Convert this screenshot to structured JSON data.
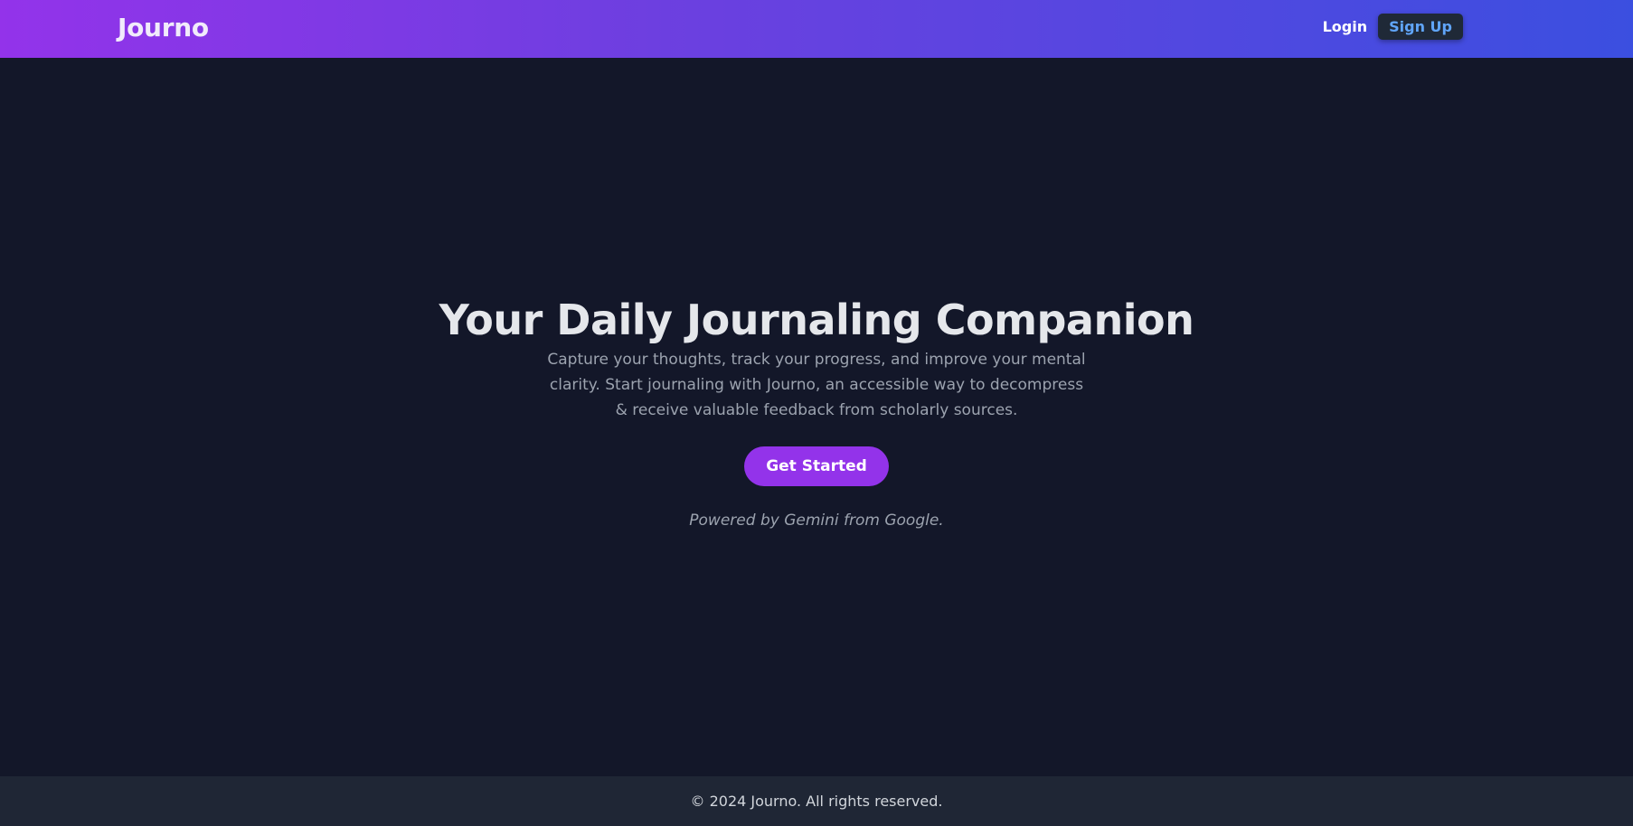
{
  "header": {
    "brand": "Journo",
    "login_label": "Login",
    "signup_label": "Sign Up"
  },
  "hero": {
    "title": "Your Daily Journaling Companion",
    "description": "Capture your thoughts, track your progress, and improve your mental clarity. Start journaling with Journo, an accessible way to decompress & receive valuable feedback from scholarly sources.",
    "cta_label": "Get Started",
    "powered_by": "Powered by Gemini from Google."
  },
  "footer": {
    "copyright": "© 2024 Journo. All rights reserved."
  },
  "colors": {
    "nav_gradient_start": "#9333ea",
    "nav_gradient_end": "#3b4fe0",
    "background": "#131729",
    "accent": "#9333ea",
    "signup_text": "#60a5fa",
    "footer_bg": "#1f2635"
  }
}
